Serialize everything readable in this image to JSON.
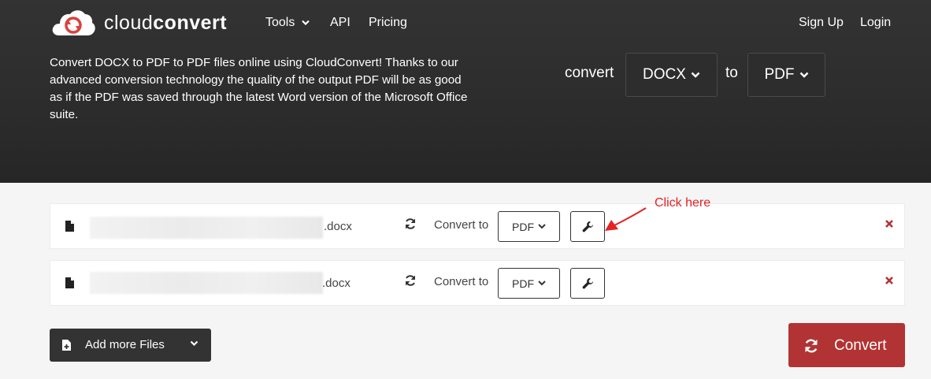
{
  "header": {
    "logo_regular": "cloud",
    "logo_bold": "convert",
    "nav": [
      {
        "label": "Tools",
        "icon": "chevron-down-icon"
      },
      {
        "label": "API"
      },
      {
        "label": "Pricing"
      }
    ],
    "sign_up": "Sign Up",
    "login": "Login"
  },
  "hero": {
    "description": "Convert DOCX to PDF to PDF files online using CloudConvert! Thanks to our advanced conversion technology the quality of the output PDF will be as good as if the PDF was saved through the latest Word version of the Microsoft Office suite.",
    "convert_label": "convert",
    "from_format": "DOCX",
    "to_label": "to",
    "to_format": "PDF"
  },
  "files": [
    {
      "name_suffix": ".docx",
      "convert_to_label": "Convert to",
      "target_format": "PDF"
    },
    {
      "name_suffix": ".docx",
      "convert_to_label": "Convert to",
      "target_format": "PDF"
    }
  ],
  "annotation": {
    "text": "Click here",
    "color": "#e22424"
  },
  "footer": {
    "add_files_label": "Add more Files",
    "convert_label": "Convert"
  },
  "colors": {
    "hero_bg": "#2c2c2c",
    "convert_button": "#b23333",
    "remove_icon": "#b23333",
    "logo_red": "#d9423d"
  },
  "icons": [
    "cloud-logo-icon",
    "chevron-down-icon",
    "file-icon",
    "sync-icon",
    "wrench-icon",
    "close-icon",
    "file-plus-icon",
    "red-arrow-icon"
  ]
}
